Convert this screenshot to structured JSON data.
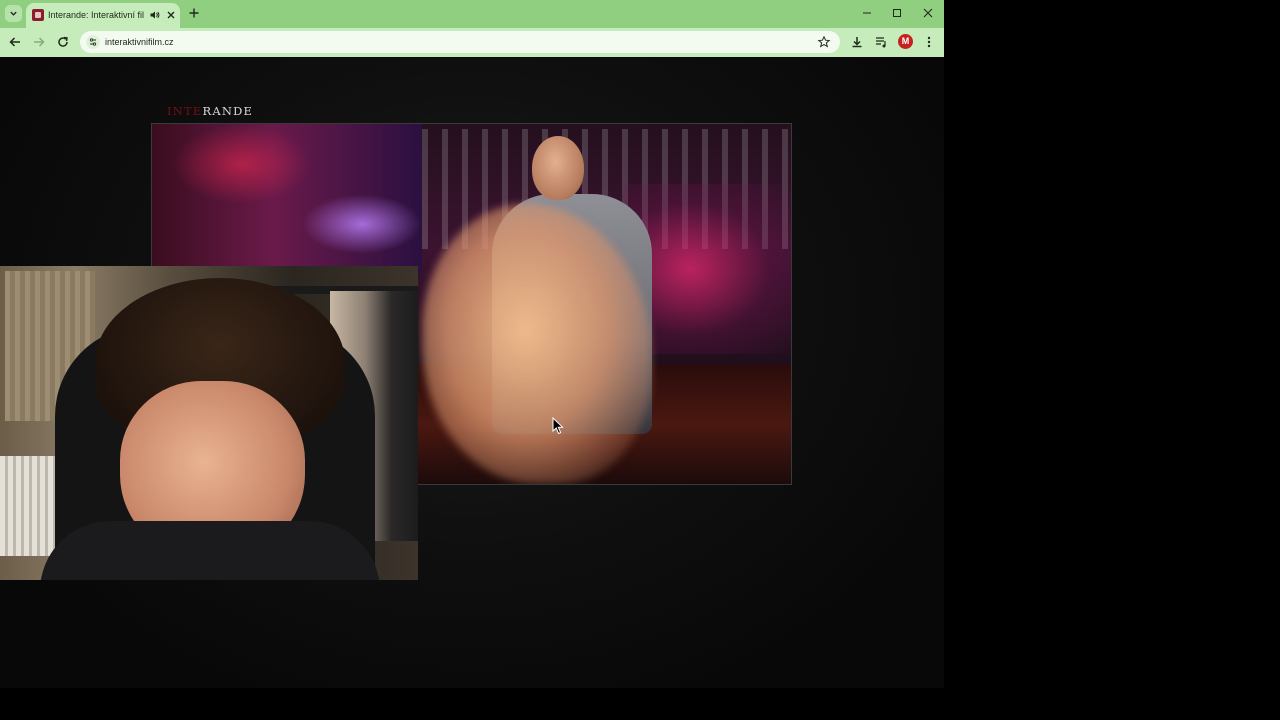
{
  "browser": {
    "tab": {
      "title": "Interande: Interaktivní film",
      "favicon": "interande-favicon-icon",
      "audio": "speaker-icon"
    },
    "toolbar": {
      "url": "interaktivnifilm.cz",
      "profile_initial": "M"
    },
    "theme_color": "#8fcf7f"
  },
  "page": {
    "logo": {
      "accent": "INTE",
      "rest": "RANDE",
      "accent_color": "#7a0d16"
    },
    "video": {
      "description_icon": "video-player"
    },
    "webcam": {
      "icon": "webcam-overlay"
    }
  }
}
